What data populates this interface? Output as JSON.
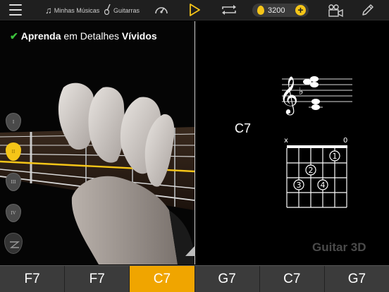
{
  "topbar": {
    "menu_icon": "hamburger-menu-icon",
    "songs_label": "Minhas Músicas",
    "guitars_label": "Guitarras",
    "coins_value": "3200",
    "add_coin_label": "+"
  },
  "left": {
    "tagline": {
      "check": "✔",
      "part1": "Aprenda",
      "part2": " em Detalhes ",
      "part3": "Vívidos"
    },
    "picks": [
      "I",
      "II",
      "III",
      "IV"
    ],
    "active_pick": "II"
  },
  "right": {
    "chord_name": "C7",
    "diagram": {
      "top_left_marker": "x",
      "top_right_marker": "0",
      "fingers": [
        "1",
        "2",
        "3",
        "4"
      ]
    },
    "brand": "Guitar 3D"
  },
  "chord_strip": [
    {
      "label": "F7",
      "active": false
    },
    {
      "label": "F7",
      "active": false
    },
    {
      "label": "C7",
      "active": true
    },
    {
      "label": "G7",
      "active": false
    },
    {
      "label": "C7",
      "active": false
    },
    {
      "label": "G7",
      "active": false
    }
  ],
  "colors": {
    "accent": "#f5c518",
    "active_chord": "#f0a500",
    "check": "#3cc13c"
  }
}
